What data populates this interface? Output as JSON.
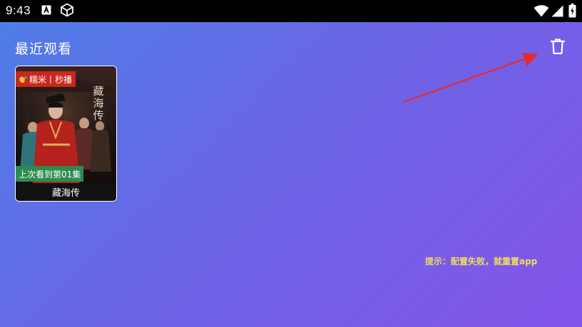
{
  "status_bar": {
    "time": "9:43",
    "icons": [
      "a-notification-icon",
      "cube-icon",
      "wifi-icon",
      "signal-icon",
      "battery-icon"
    ]
  },
  "header": {
    "title": "最近观看",
    "clear_icon": "trash-icon"
  },
  "history": {
    "items": [
      {
        "title": "藏海传",
        "source_badge": "糯米丨秒播",
        "progress": "上次看到第01集",
        "poster_text": "藏海传"
      }
    ]
  },
  "hint": "提示：配置失败，就重置app",
  "colors": {
    "bg_start": "#4c7ee6",
    "bg_end": "#8554ea",
    "badge_red": "#c8281e",
    "badge_green": "#2e8b4f",
    "hint_yellow": "#f0dd5c",
    "arrow_red": "#e8282a"
  }
}
